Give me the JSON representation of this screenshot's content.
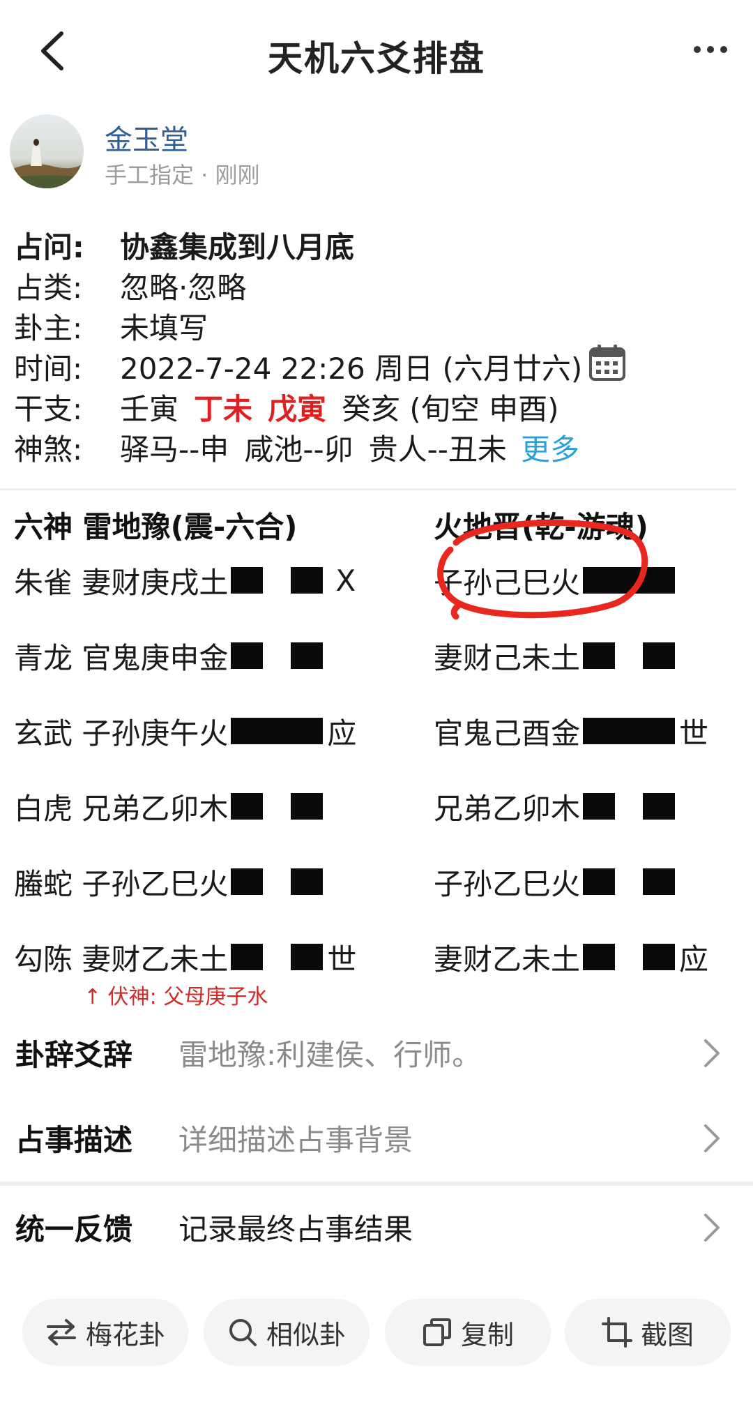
{
  "header": {
    "title": "天机六爻排盘"
  },
  "author": {
    "name": "金玉堂",
    "meta": "手工指定 · 刚刚"
  },
  "info": {
    "question": {
      "label": "占问:",
      "value": "协鑫集成到八月底"
    },
    "category": {
      "label": "占类:",
      "value": "忽略·忽略"
    },
    "owner": {
      "label": "卦主:",
      "value": "未填写"
    },
    "time": {
      "label": "时间:",
      "value": "2022-7-24 22:26 周日 (六月廿六)"
    },
    "ganzhi": {
      "label": "干支:",
      "p1": "壬寅",
      "p2": "丁未",
      "p3": "戊寅",
      "p4": "癸亥 (旬空 申酉)"
    },
    "shensha": {
      "label": "神煞:",
      "v1": "驿马--申",
      "v2": "咸池--卯",
      "v3": "贵人--丑未",
      "more": "更多"
    }
  },
  "hexagram": {
    "left_header": "六神 雷地豫(震-六合)",
    "right_header": "火地晋(乾-游魂)",
    "rows": [
      {
        "left": "朱雀 妻财庚戌土",
        "left_mark": "X",
        "right": "子孙己巳火",
        "right_mark": ""
      },
      {
        "left": "青龙 官鬼庚申金",
        "left_mark": "",
        "right": "妻财己未土",
        "right_mark": ""
      },
      {
        "left": "玄武 子孙庚午火",
        "left_mark": "应",
        "right": "官鬼己酉金",
        "right_mark": "世"
      },
      {
        "left": "白虎 兄弟乙卯木",
        "left_mark": "",
        "right": "兄弟乙卯木",
        "right_mark": ""
      },
      {
        "left": "螣蛇 子孙乙巳火",
        "left_mark": "",
        "right": "子孙乙巳火",
        "right_mark": ""
      },
      {
        "left": "勾陈 妻财乙未土",
        "left_mark": "世",
        "right": "妻财乙未土",
        "right_mark": "应"
      }
    ],
    "fushen": "↑ 伏神: 父母庚子水"
  },
  "links": {
    "guaci": {
      "label": "卦辞爻辞",
      "value": "雷地豫:利建侯、行师。"
    },
    "describe": {
      "label": "占事描述",
      "value": "详细描述占事背景"
    },
    "feedback": {
      "label": "统一反馈",
      "value": "记录最终占事结果"
    }
  },
  "toolbar": {
    "meihua": "梅花卦",
    "similar": "相似卦",
    "copy": "复制",
    "screenshot": "截图"
  },
  "colors": {
    "accent_red": "#e02020",
    "link_blue": "#2aa0d8",
    "author_blue": "#2f5e97",
    "annotation_red": "#e8281e"
  }
}
